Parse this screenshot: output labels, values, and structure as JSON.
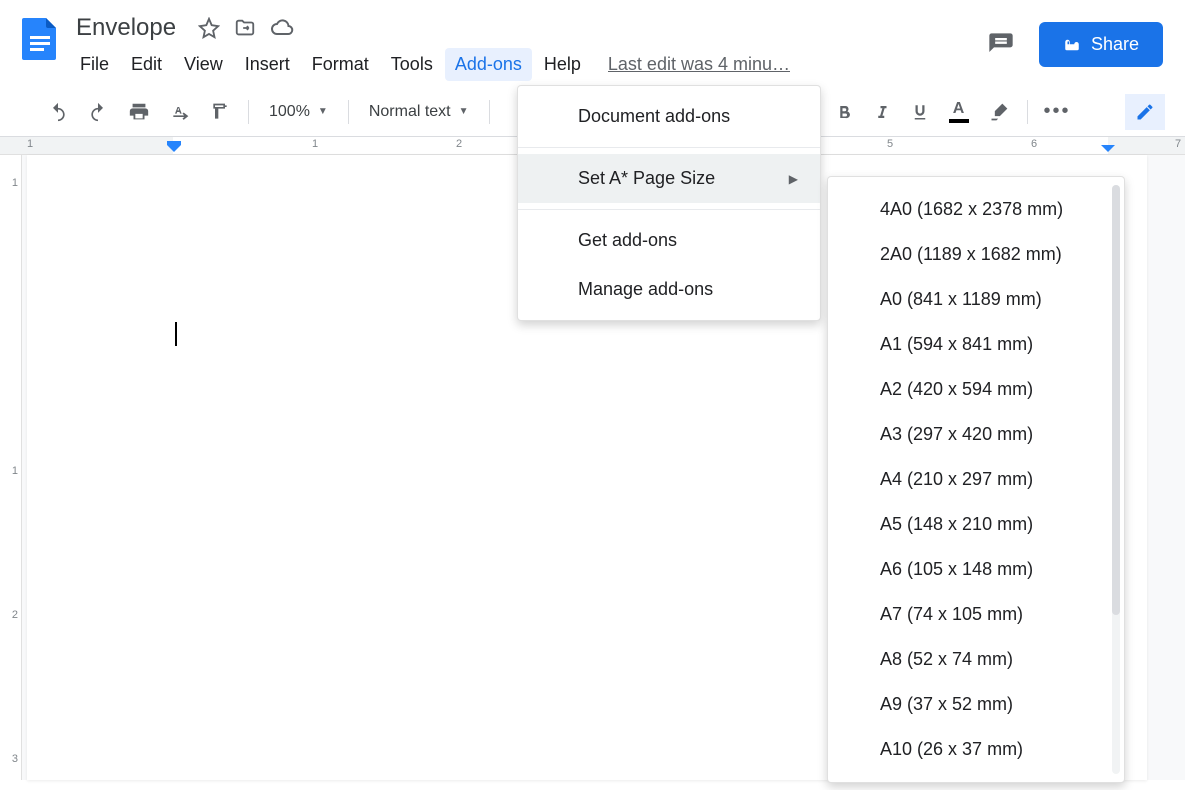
{
  "doc_title": "Envelope",
  "menubar": [
    "File",
    "Edit",
    "View",
    "Insert",
    "Format",
    "Tools",
    "Add-ons",
    "Help"
  ],
  "active_menu_index": 6,
  "last_edit": "Last edit was 4 minu…",
  "share_label": "Share",
  "toolbar": {
    "zoom": "100%",
    "style": "Normal text"
  },
  "ruler_h_labels": [
    "1",
    "1",
    "2",
    "5",
    "6",
    "7"
  ],
  "ruler_v_labels": [
    "1",
    "1",
    "2",
    "3"
  ],
  "addons_menu": {
    "document_addons": "Document add-ons",
    "set_page_size": "Set A* Page Size",
    "get_addons": "Get add-ons",
    "manage_addons": "Manage add-ons"
  },
  "page_sizes": [
    "4A0 (1682 x 2378 mm)",
    "2A0 (1189 x 1682 mm)",
    "A0 (841 x 1189 mm)",
    "A1 (594 x 841 mm)",
    "A2 (420 x 594 mm)",
    "A3 (297 x 420 mm)",
    "A4 (210 x 297 mm)",
    "A5 (148 x 210 mm)",
    "A6 (105 x 148 mm)",
    "A7 (74 x 105 mm)",
    "A8 (52 x 74 mm)",
    "A9 (37 x 52 mm)",
    "A10 (26 x 37 mm)"
  ]
}
